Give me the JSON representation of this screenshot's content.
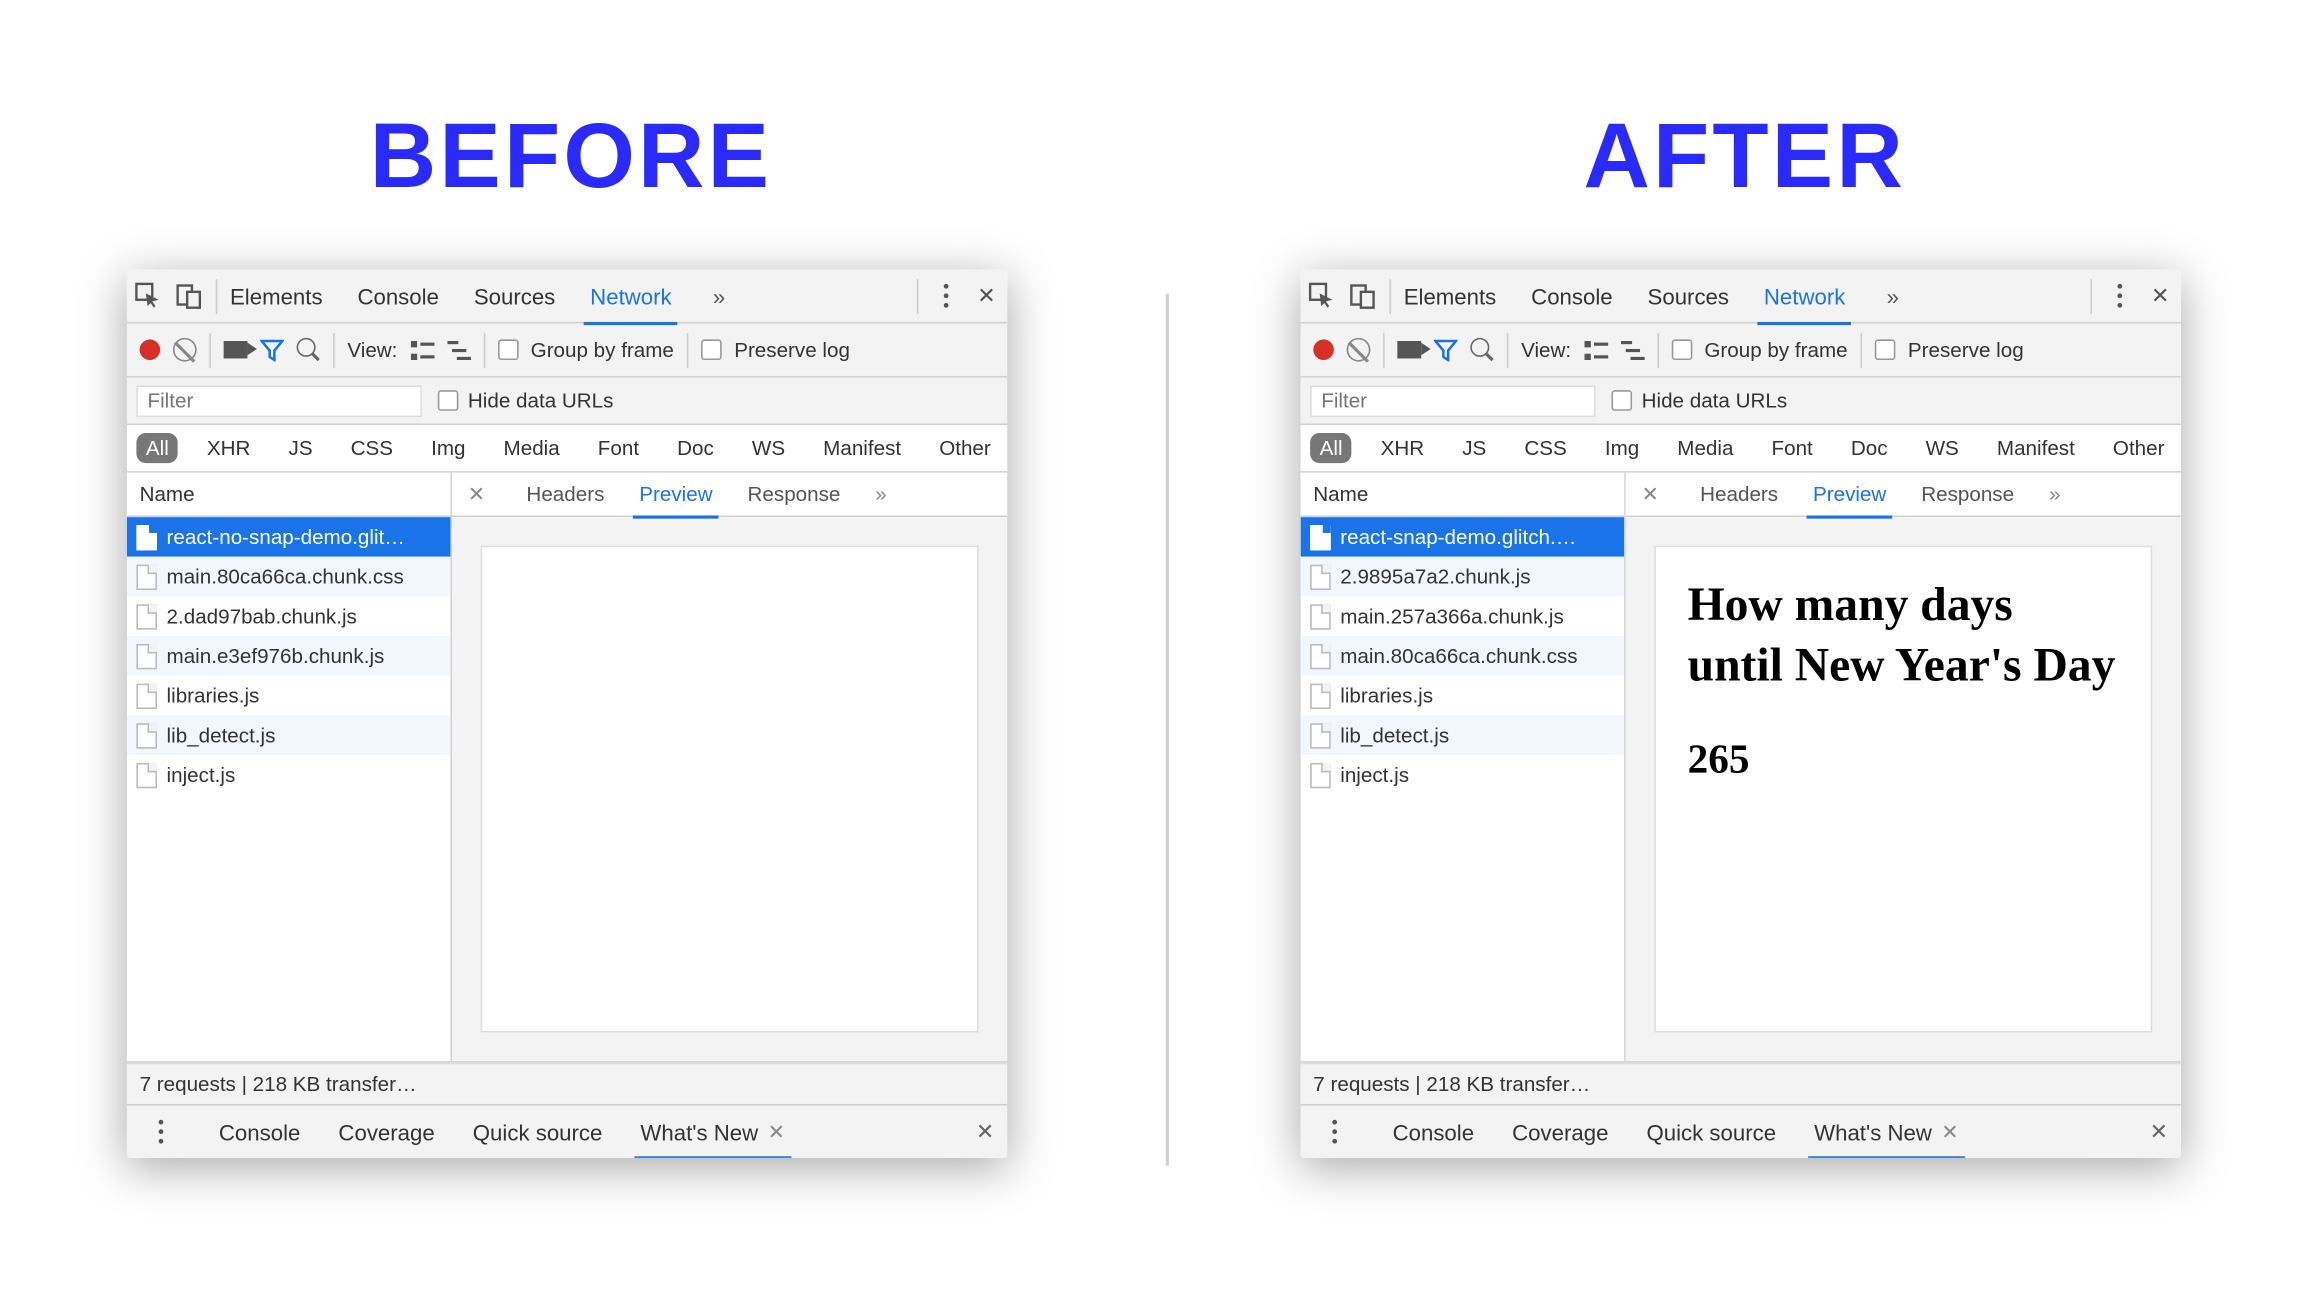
{
  "headings": {
    "before": "BEFORE",
    "after": "AFTER"
  },
  "tabs": {
    "items": [
      "Elements",
      "Console",
      "Sources",
      "Network"
    ],
    "activeIndex": 3
  },
  "toolbar": {
    "view_label": "View:",
    "group_by_frame": "Group by frame",
    "preserve_log": "Preserve log"
  },
  "filter": {
    "placeholder": "Filter",
    "hide_data_urls": "Hide data URLs"
  },
  "types": [
    "All",
    "XHR",
    "JS",
    "CSS",
    "Img",
    "Media",
    "Font",
    "Doc",
    "WS",
    "Manifest",
    "Other"
  ],
  "name_header": "Name",
  "detail_tabs": [
    "Headers",
    "Preview",
    "Response"
  ],
  "detail_active_index": 1,
  "status": "7 requests | 218 KB transfer…",
  "drawer": {
    "items": [
      "Console",
      "Coverage",
      "Quick source",
      "What's New"
    ],
    "activeIndex": 3
  },
  "panels": {
    "before": {
      "requests": [
        "react-no-snap-demo.glit…",
        "main.80ca66ca.chunk.css",
        "2.dad97bab.chunk.js",
        "main.e3ef976b.chunk.js",
        "libraries.js",
        "lib_detect.js",
        "inject.js"
      ],
      "preview": {
        "heading": "",
        "value": ""
      }
    },
    "after": {
      "requests": [
        "react-snap-demo.glitch.…",
        "2.9895a7a2.chunk.js",
        "main.257a366a.chunk.js",
        "main.80ca66ca.chunk.css",
        "libraries.js",
        "lib_detect.js",
        "inject.js"
      ],
      "preview": {
        "heading": "How many days until New Year's Day",
        "value": "265"
      }
    }
  }
}
